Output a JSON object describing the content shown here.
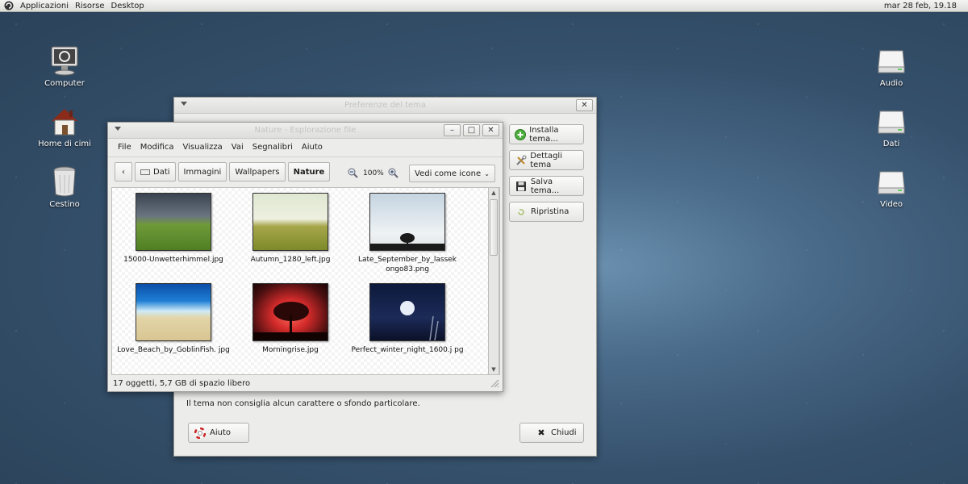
{
  "panel": {
    "menus": [
      "Applicazioni",
      "Risorse",
      "Desktop"
    ],
    "clock": "mar 28 feb, 19.18"
  },
  "desktop": {
    "left_icons": [
      "Computer",
      "Home di cimi",
      "Cestino"
    ],
    "right_icons": [
      "Audio",
      "Dati",
      "Video"
    ]
  },
  "theme_window": {
    "title": "Preferenze del tema",
    "buttons": {
      "install": "Installa tema...",
      "details": "Dettagli tema",
      "save": "Salva tema...",
      "restore": "Ripristina",
      "help": "Aiuto",
      "close": "Chiudi"
    },
    "message": "Il tema non consiglia alcun carattere o sfondo particolare."
  },
  "file_window": {
    "title": "Nature - Esplorazione file",
    "menus": [
      "File",
      "Modifica",
      "Visualizza",
      "Vai",
      "Segnalibri",
      "Aiuto"
    ],
    "breadcrumbs": [
      "Dati",
      "Immagini",
      "Wallpapers",
      "Nature"
    ],
    "zoom": "100%",
    "view_mode": "Vedi come icone",
    "files": [
      {
        "name": "15000-Unwetterhimmel.jpg"
      },
      {
        "name": "Autumn_1280_left.jpg"
      },
      {
        "name": "Late_September_by_lassek ongo83.png"
      },
      {
        "name": "Love_Beach_by_GoblinFish. jpg"
      },
      {
        "name": "Morningrise.jpg"
      },
      {
        "name": "Perfect_winter_night_1600.j pg"
      }
    ],
    "status": "17 oggetti, 5,7 GB di spazio libero"
  }
}
